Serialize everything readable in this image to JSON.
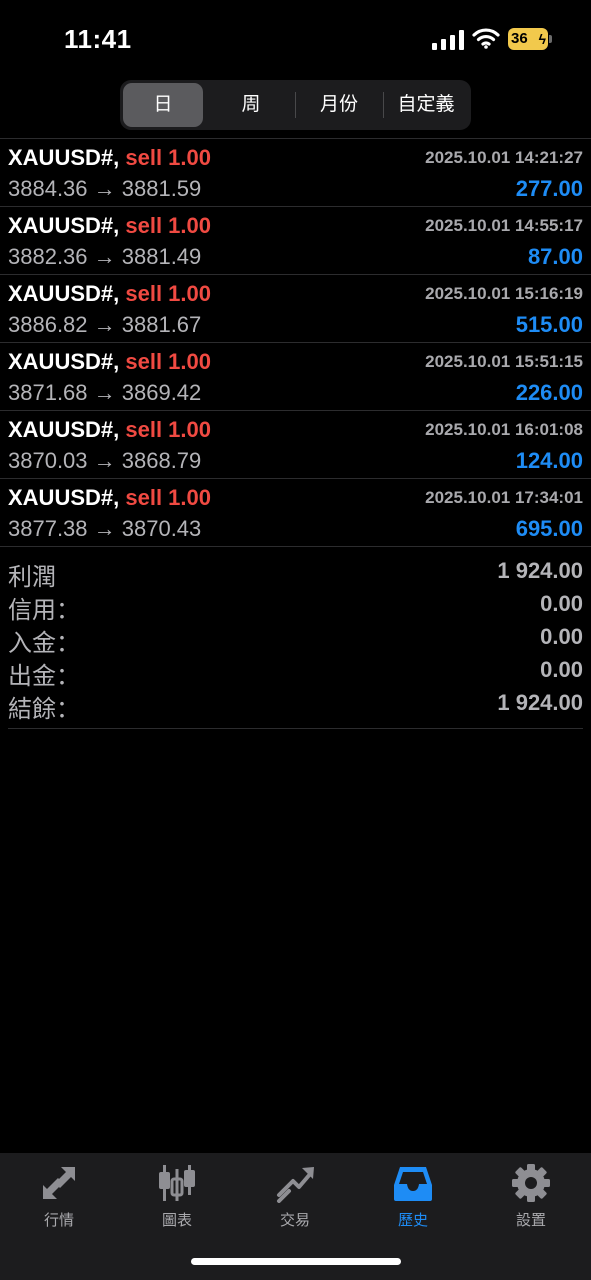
{
  "status": {
    "time": "11:41",
    "battery": "36"
  },
  "segments": [
    {
      "label": "日",
      "active": true
    },
    {
      "label": "周",
      "active": false
    },
    {
      "label": "月份",
      "active": false
    },
    {
      "label": "自定義",
      "active": false
    }
  ],
  "trades": [
    {
      "symbol": "XAUUSD#,",
      "side": "sell 1.00",
      "datetime": "2025.10.01 14:21:27",
      "prices": "3884.36 → 3881.59",
      "profit": "277.00"
    },
    {
      "symbol": "XAUUSD#,",
      "side": "sell 1.00",
      "datetime": "2025.10.01 14:55:17",
      "prices": "3882.36 → 3881.49",
      "profit": "87.00"
    },
    {
      "symbol": "XAUUSD#,",
      "side": "sell 1.00",
      "datetime": "2025.10.01 15:16:19",
      "prices": "3886.82 → 3881.67",
      "profit": "515.00"
    },
    {
      "symbol": "XAUUSD#,",
      "side": "sell 1.00",
      "datetime": "2025.10.01 15:51:15",
      "prices": "3871.68 → 3869.42",
      "profit": "226.00"
    },
    {
      "symbol": "XAUUSD#,",
      "side": "sell 1.00",
      "datetime": "2025.10.01 16:01:08",
      "prices": "3870.03 → 3868.79",
      "profit": "124.00"
    },
    {
      "symbol": "XAUUSD#,",
      "side": "sell 1.00",
      "datetime": "2025.10.01 17:34:01",
      "prices": "3877.38 → 3870.43",
      "profit": "695.00"
    }
  ],
  "summary": [
    {
      "label": "利潤",
      "value": "1 924.00"
    },
    {
      "label": "信用：",
      "value": "0.00"
    },
    {
      "label": "入金：",
      "value": "0.00"
    },
    {
      "label": "出金：",
      "value": "0.00"
    },
    {
      "label": "結餘：",
      "value": "1 924.00"
    }
  ],
  "tabbar": [
    {
      "label": "行情",
      "icon": "quotes-icon",
      "active": false
    },
    {
      "label": "圖表",
      "icon": "chart-icon",
      "active": false
    },
    {
      "label": "交易",
      "icon": "trade-icon",
      "active": false
    },
    {
      "label": "歷史",
      "icon": "history-icon",
      "active": true
    },
    {
      "label": "設置",
      "icon": "settings-icon",
      "active": false
    }
  ],
  "colors": {
    "accent": "#1e8cf5",
    "sell": "#f04a42",
    "background": "#000000",
    "muted": "#a9a9ad"
  }
}
